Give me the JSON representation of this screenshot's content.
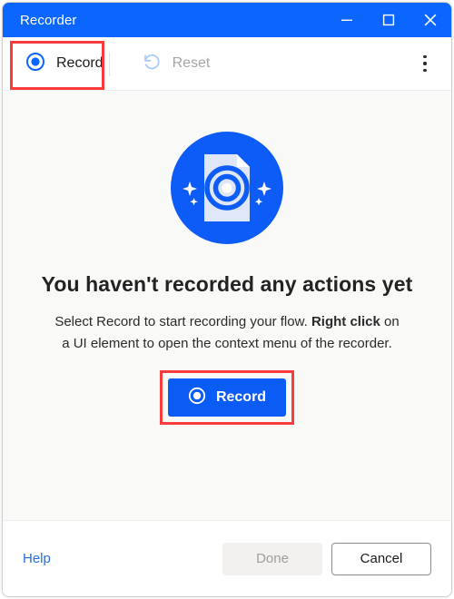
{
  "window": {
    "title": "Recorder",
    "controls": [
      {
        "name": "minimize-button",
        "icon": "minimize-icon",
        "label": "Minimize"
      },
      {
        "name": "maximize-button",
        "icon": "maximize-icon",
        "label": "Maximize"
      },
      {
        "name": "close-button",
        "icon": "close-icon",
        "label": "Close"
      }
    ]
  },
  "toolbar": {
    "record_label": "Record",
    "record_icon": "record-circle-icon",
    "reset_label": "Reset",
    "reset_icon": "reset-undo-icon",
    "overflow_label": "More options",
    "overflow_icon": "more-vertical-icon"
  },
  "content": {
    "hero_icon": "document-record-illustration",
    "title": "You haven't recorded any actions yet",
    "description_line1": "Select Record to start recording your flow.",
    "description_strong": "Right click",
    "description_line2": " on a UI element to open the context",
    "description_line3": "menu of the recorder.",
    "record_button_label": "Record",
    "record_button_icon": "record-circle-icon"
  },
  "footer": {
    "help_label": "Help",
    "done_label": "Done",
    "cancel_label": "Cancel"
  },
  "colors": {
    "title_bar_blue": "#0a66ff",
    "accent_blue": "#0a5cf5",
    "link_blue": "#1f6fe5",
    "highlight_red": "#fa3c3c",
    "content_background": "#f9f9f7",
    "disabled_gray": "#9f9f9f"
  }
}
